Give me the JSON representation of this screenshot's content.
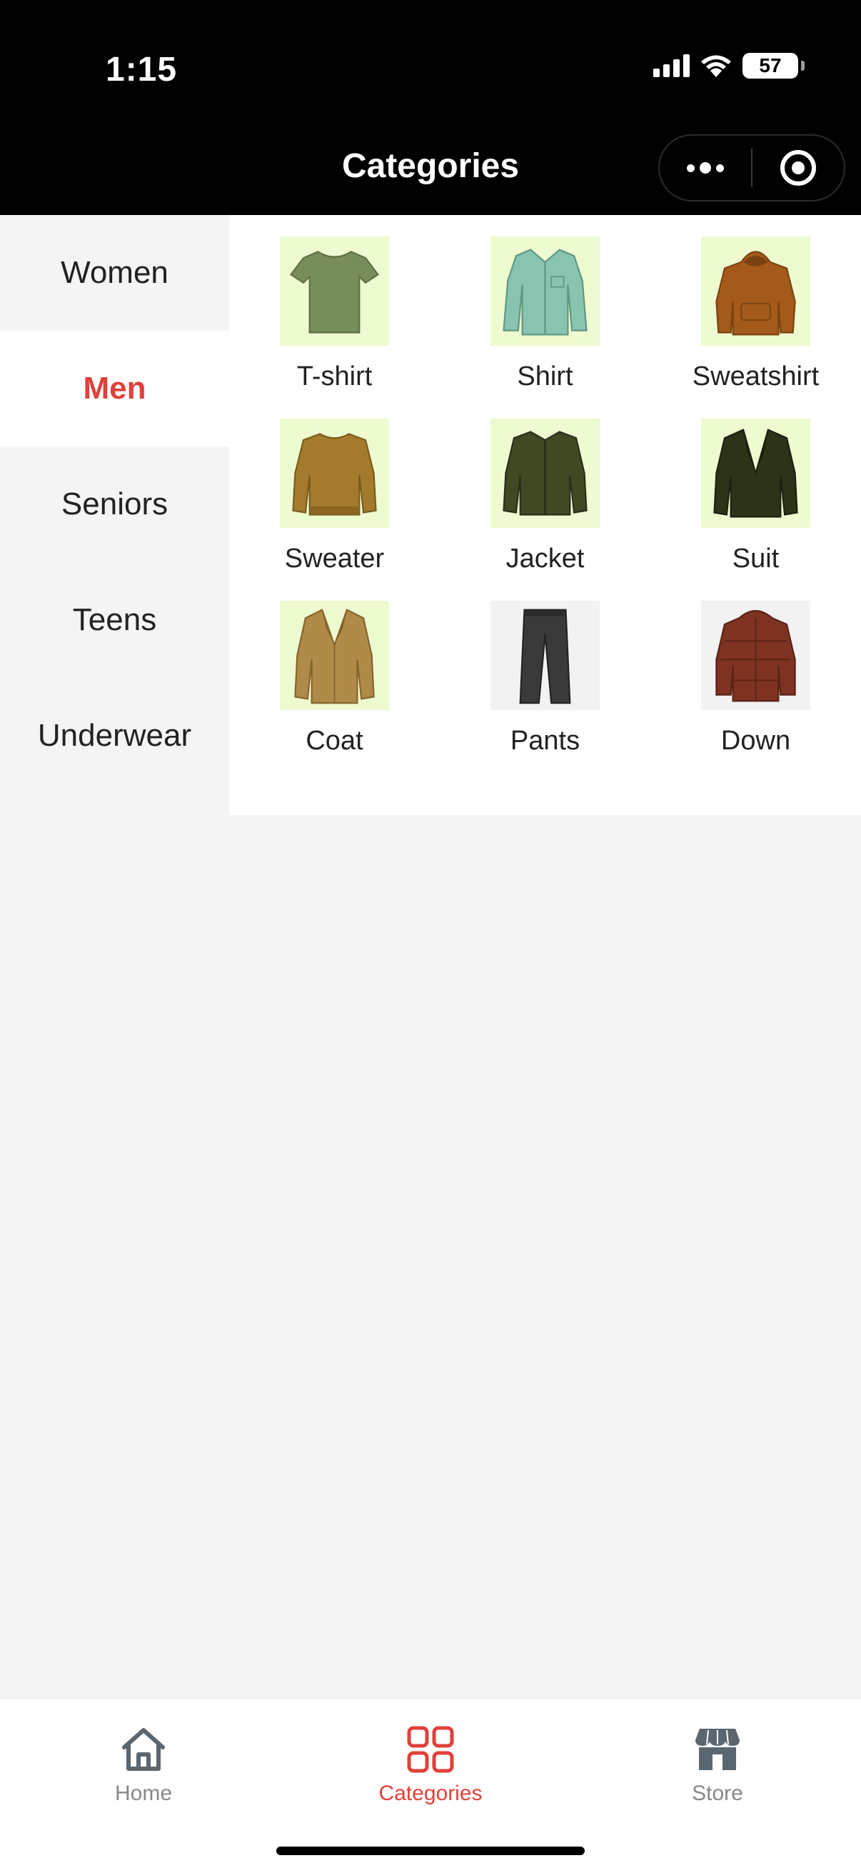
{
  "status_bar": {
    "time": "1:15",
    "battery": "57"
  },
  "header": {
    "title": "Categories"
  },
  "sidebar": {
    "items": [
      {
        "label": "Women",
        "active": false
      },
      {
        "label": "Men",
        "active": true
      },
      {
        "label": "Seniors",
        "active": false
      },
      {
        "label": "Teens",
        "active": false
      },
      {
        "label": "Underwear",
        "active": false
      }
    ]
  },
  "products": [
    {
      "label": "T-shirt",
      "icon": "tshirt-image"
    },
    {
      "label": "Shirt",
      "icon": "shirt-image"
    },
    {
      "label": "Sweatshirt",
      "icon": "sweatshirt-image"
    },
    {
      "label": "Sweater",
      "icon": "sweater-image"
    },
    {
      "label": "Jacket",
      "icon": "jacket-image"
    },
    {
      "label": "Suit",
      "icon": "suit-image"
    },
    {
      "label": "Coat",
      "icon": "coat-image"
    },
    {
      "label": "Pants",
      "icon": "pants-image"
    },
    {
      "label": "Down",
      "icon": "down-jacket-image"
    }
  ],
  "tabbar": {
    "items": [
      {
        "label": "Home",
        "icon": "home-icon",
        "active": false
      },
      {
        "label": "Categories",
        "icon": "categories-icon",
        "active": true
      },
      {
        "label": "Store",
        "icon": "store-icon",
        "active": false
      }
    ]
  },
  "colors": {
    "accent": "#e0413b",
    "header_bg": "#000000",
    "page_bg": "#f4f4f4"
  }
}
